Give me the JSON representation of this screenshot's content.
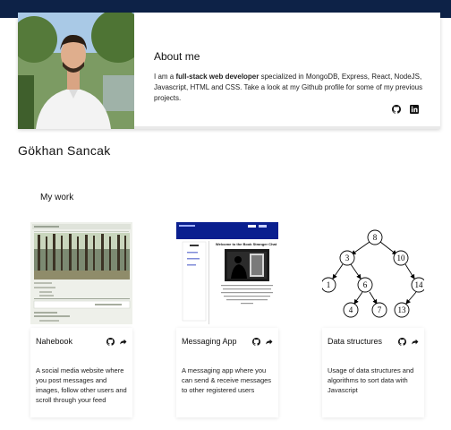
{
  "profile": {
    "name": "Gökhan Sancak",
    "about_title": "About me",
    "about_pre": "I am a ",
    "about_bold": "full-stack web developer",
    "about_post": " specialized in MongoDB, Express, React, NodeJS, Javascript, HTML and CSS. Take a look at my Github profile for some of my previous projects.",
    "icons": [
      "github-icon",
      "linkedin-icon"
    ]
  },
  "work": {
    "title": "My work",
    "projects": [
      {
        "title": "Nahebook",
        "description": "A social media website where you post messages and images, follow other users and scroll through your feed",
        "icons": [
          "github-icon",
          "share-icon"
        ]
      },
      {
        "title": "Messaging App",
        "description": "A messaging app where you can send & receive messages to other registered users",
        "icons": [
          "github-icon",
          "share-icon"
        ]
      },
      {
        "title": "Data structures",
        "description": "Usage of data structures and algorithms to sort data with Javascript",
        "icons": [
          "github-icon",
          "share-icon"
        ]
      }
    ]
  },
  "thumbnails": {
    "messaging_heading": "Welcome to the Book Stranger Chat",
    "tree_nodes": [
      "8",
      "3",
      "10",
      "1",
      "6",
      "14",
      "4",
      "7",
      "13"
    ]
  },
  "colors": {
    "header_band": "#0d2247",
    "messaging_bar": "#0a1f8f"
  }
}
